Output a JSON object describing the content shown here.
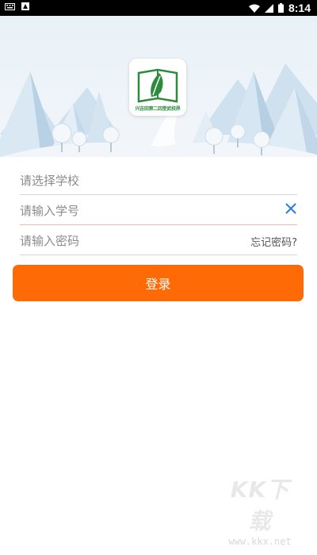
{
  "status_bar": {
    "time": "8:14",
    "left_icons": [
      "keyboard-icon",
      "app-notification-icon"
    ],
    "right_icons": [
      "wifi-icon",
      "signal-icon",
      "battery-icon"
    ]
  },
  "logo": {
    "caption": "兴吉田第二四堂武校界",
    "icon": "book-leaf-logo"
  },
  "form": {
    "school_placeholder": "请选择学校",
    "student_id_placeholder": "请输入学号",
    "password_placeholder": "请输入密码",
    "forgot_label": "忘记密码?",
    "login_label": "登录"
  },
  "colors": {
    "accent": "#fe6a06",
    "clear_icon": "#2a7de1",
    "active_underline": "#f0b9a1"
  },
  "watermark": {
    "main": "KK下载",
    "sub": "www.kkx.net"
  }
}
